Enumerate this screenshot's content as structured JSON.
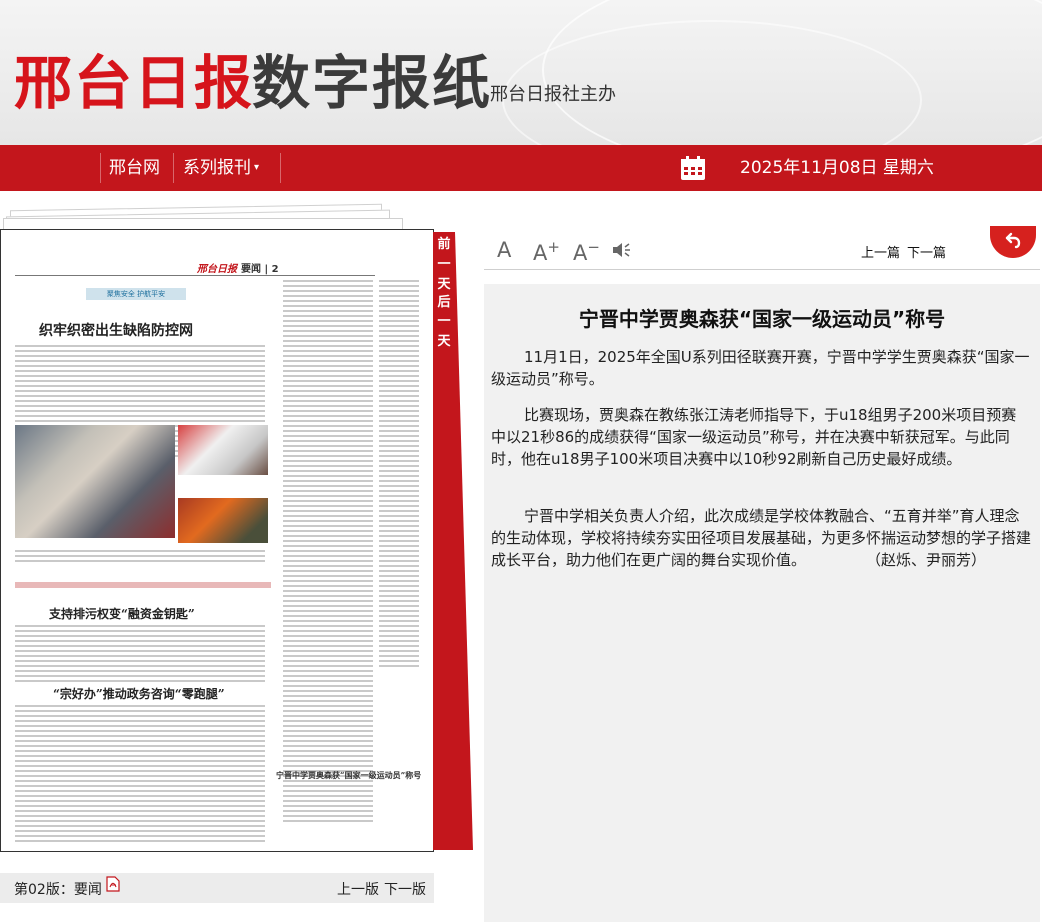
{
  "header": {
    "brand_red": "邢台日报",
    "brand_dark": "数字报纸",
    "brand_sub": "邢台日报社主办"
  },
  "nav": {
    "home": "邢台网",
    "series": "系列报刊",
    "date": "2025年11月08日 星期六"
  },
  "ribbon": {
    "prev_day": [
      "前",
      "一",
      "天"
    ],
    "next_day": [
      "后",
      "一",
      "天"
    ]
  },
  "page_preview": {
    "brand": "邢台日报",
    "section": "要闻 | 2",
    "tag": "聚焦安全 护航平安",
    "headline1": "织牢织密出生缺陷防控网",
    "headline2": "支持排污权变“融资金钥匙”",
    "headline3": "“宗好办”推动政务咨询“零跑腿”",
    "headline4": "宁晋中学贾奥森获“国家一级运动员”称号"
  },
  "page_footer": {
    "label": "第02版：要闻",
    "prev": "上一版",
    "next": "下一版"
  },
  "toolbar": {
    "font_normal": "A",
    "font_larger": "A",
    "font_larger_sign": "+",
    "font_smaller": "A",
    "font_smaller_sign": "−",
    "prev_article": "上一篇",
    "next_article": "下一篇"
  },
  "article": {
    "title": "宁晋中学贾奥森获“国家一级运动员”称号",
    "paragraphs": [
      "11月1日，2025年全国U系列田径联赛开赛，宁晋中学学生贾奥森获“国家一级运动员”称号。",
      "比赛现场，贾奥森在教练张江涛老师指导下，于u18组男子200米项目预赛中以21秒86的成绩获得“国家一级运动员”称号，并在决赛中斩获冠军。与此同时，他在u18男子100米项目决赛中以10秒92刷新自己历史最好成绩。",
      "宁晋中学相关负责人介绍，此次成绩是学校体教融合、“五育并举”育人理念的生动体现，学校将持续夯实田径项目发展基础，为更多怀揣运动梦想的学子搭建成长平台，助力他们在更广阔的舞台实现价值。　　　　　（赵烁、尹丽芳）"
    ]
  },
  "colors": {
    "brand_red": "#d6141b",
    "nav_red": "#c3161c",
    "article_bg": "#f1f1f1"
  },
  "icons": {
    "calendar": "calendar-icon",
    "speaker": "speaker-icon",
    "back": "back-arrow-icon",
    "pdf": "pdf-icon"
  }
}
